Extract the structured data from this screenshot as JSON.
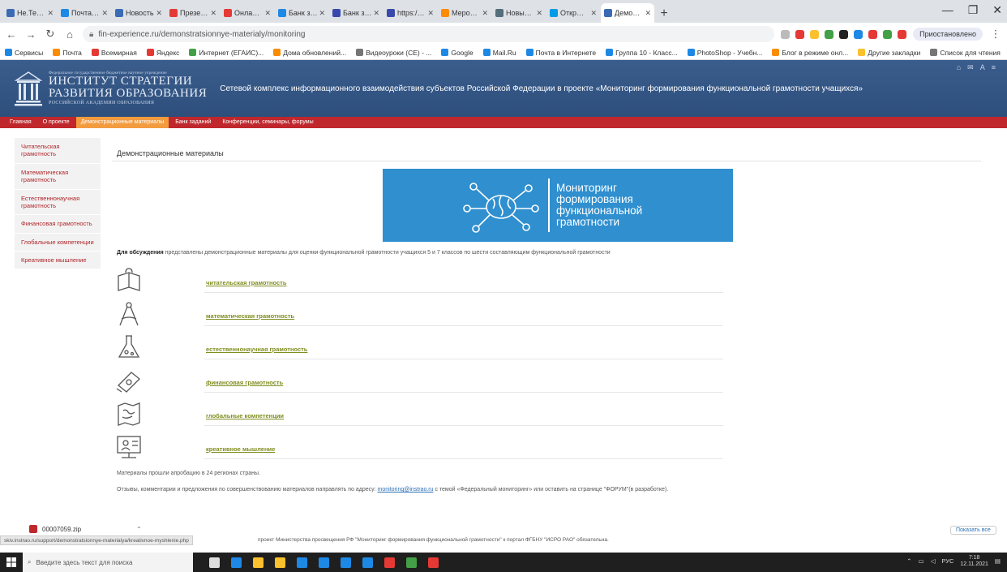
{
  "browser": {
    "tabs": [
      {
        "title": "Не.Термин",
        "color": "#3b6bb5"
      },
      {
        "title": "Почта Mail.ru",
        "color": "#1e88e5"
      },
      {
        "title": "Новость",
        "color": "#3b6bb5"
      },
      {
        "title": "Презентац.",
        "color": "#e53935"
      },
      {
        "title": "Онлайн-об.",
        "color": "#e53935"
      },
      {
        "title": "Банк заданий",
        "color": "#1e88e5"
      },
      {
        "title": "Банк заданий",
        "color": "#3949ab"
      },
      {
        "title": "https://clas",
        "color": "#3949ab"
      },
      {
        "title": "Мероприятия",
        "color": "#fb8c00"
      },
      {
        "title": "Новый вкладка",
        "color": "#546e7a"
      },
      {
        "title": "Открытый",
        "color": "#039be5"
      },
      {
        "title": "Демонстрац.",
        "color": "#3b6bb5",
        "active": true
      }
    ],
    "new_tab": "+",
    "window_controls": [
      "—",
      "❐",
      "✕"
    ],
    "url": "fin-experience.ru/demonstratsionnye-materialy/monitoring",
    "profile": "Приостановлено",
    "extension_colors": [
      "#bbb",
      "#e53935",
      "#fbc02d",
      "#43a047",
      "#212121",
      "#1e88e5",
      "#e53935",
      "#43a047",
      "#e53935"
    ],
    "bookmarks": [
      {
        "label": "Сервисы",
        "color": "#1e88e5"
      },
      {
        "label": "Почта",
        "color": "#fb8c00"
      },
      {
        "label": "Всемирная",
        "color": "#e53935"
      },
      {
        "label": "Яндекс",
        "color": "#e53935"
      },
      {
        "label": "Интернет (ЕГАИС)...",
        "color": "#43a047"
      },
      {
        "label": "Дома обновлений...",
        "color": "#fb8c00"
      },
      {
        "label": "Видеоуроки (СЕ) - ...",
        "color": "#757575"
      },
      {
        "label": "Google",
        "color": "#1e88e5"
      },
      {
        "label": "Mail.Ru",
        "color": "#1e88e5"
      },
      {
        "label": "Почта в Интернете",
        "color": "#1e88e5"
      },
      {
        "label": "Группа 10 - Класс...",
        "color": "#1e88e5"
      },
      {
        "label": "PhotoShop - Учебн...",
        "color": "#1e88e5"
      },
      {
        "label": "Блог в режиме онл...",
        "color": "#fb8c00"
      },
      {
        "label": "Другие закладки",
        "color": "#fbc02d"
      },
      {
        "label": "Список для чтения",
        "color": "#757575"
      }
    ]
  },
  "header": {
    "logo_small": "Федеральное государственное бюджетное научное учреждение",
    "logo_line1": "ИНСТИТУТ СТРАТЕГИИ",
    "logo_line2": "РАЗВИТИЯ ОБРАЗОВАНИЯ",
    "logo_line3": "РОССИЙСКОЙ АКАДЕМИИ ОБРАЗОВАНИЯ",
    "title": "Сетевой комплекс информационного взаимодействия субъектов Российской Федерации в проекте «Мониторинг формирования функциональной грамотности учащихся»",
    "icons": [
      "⌂",
      "✉",
      "A",
      "≡"
    ]
  },
  "nav": [
    {
      "label": "Главная",
      "active": false
    },
    {
      "label": "О проекте",
      "active": false
    },
    {
      "label": "Демонстрационные материалы",
      "active": true
    },
    {
      "label": "Банк заданий",
      "active": false
    },
    {
      "label": "Конференции, семинары, форумы",
      "active": false
    }
  ],
  "sidebar": [
    {
      "label": "Читательская грамотность"
    },
    {
      "label": "Математическая грамотность"
    },
    {
      "label": "Естественнонаучная грамотность"
    },
    {
      "label": "Финансовая грамотность"
    },
    {
      "label": "Глобальные компетенции"
    },
    {
      "label": "Креативное мышление"
    }
  ],
  "main": {
    "title": "Демонстрационные материалы",
    "banner": {
      "line1": "Мониторинг",
      "line2": "формирования",
      "line3": "функциональной",
      "line4": "грамотности"
    },
    "intro_bold": "Для обсуждения",
    "intro_rest": " представлены демонстрационные материалы для оценки функциональной грамотности учащихся 5 и 7 классов по шести составляющим функциональной грамотности",
    "links": [
      {
        "label": "читательская грамотность",
        "icon": "book-icon"
      },
      {
        "label": "математическая грамотность",
        "icon": "compass-icon"
      },
      {
        "label": "естественнонаучная грамотность",
        "icon": "flask-icon"
      },
      {
        "label": "финансовая грамотность",
        "icon": "money-icon"
      },
      {
        "label": "глобальные компетенции",
        "icon": "map-icon"
      },
      {
        "label": "креативное мышление",
        "icon": "presentation-icon"
      }
    ],
    "note1": "Материалы прошли апробацию в 24 регионах страны.",
    "note2_pre": "Отзывы, комментарии и предложения по совершенствованию материалов направлять по адресу: ",
    "note2_mail": "monitoring@instrao.ru",
    "note2_post": " с темой «Федеральный мониторинг» или оставить на странице \"ФОРУМ\"(в разработке)."
  },
  "status": {
    "url": "skiv.instrao.ru/support/demonstratsionnye-materialya/kreativnoe-myshlenie.php",
    "footer": "проект Министерства просвещения РФ \"Мониторинг формирования функциональной грамотности\" к портал ФГБНУ \"ИСРО РАО\" обязательна."
  },
  "downloads": {
    "file": "00007059.zip",
    "chevron": "⌃",
    "show_all": "Показать все"
  },
  "taskbar": {
    "search_placeholder": "Введите здесь текст для поиска",
    "icon_colors": [
      "#ddd",
      "#1e88e5",
      "#fbc02d",
      "#fbc02d",
      "#1e88e5",
      "#1e88e5",
      "#1e88e5",
      "#1e88e5",
      "#e53935",
      "#43a047",
      "#e53935"
    ],
    "tray_lang": "РУС",
    "time": "7:18",
    "date": "12.11.2021"
  }
}
